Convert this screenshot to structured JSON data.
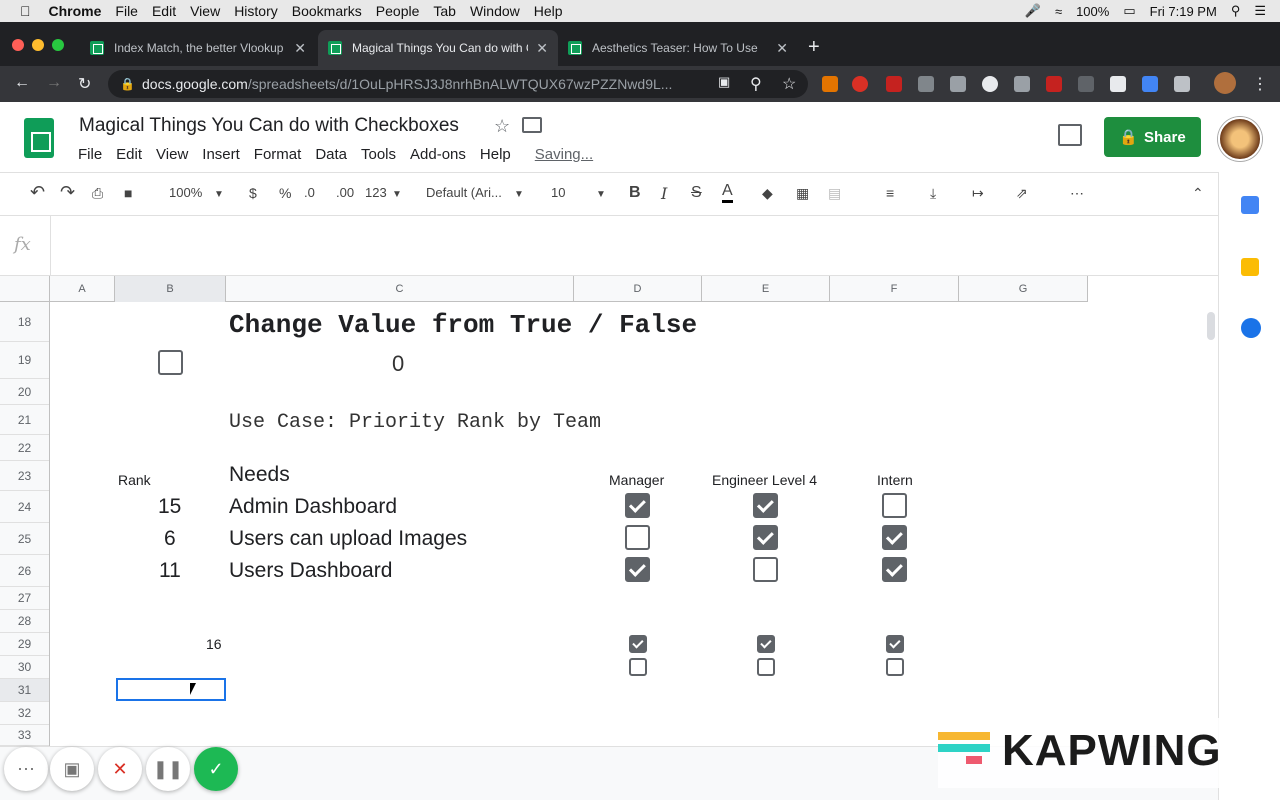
{
  "macos_menubar": {
    "app_name": "Chrome",
    "menus": [
      "File",
      "Edit",
      "View",
      "History",
      "Bookmarks",
      "People",
      "Tab",
      "Window",
      "Help"
    ],
    "battery": "100%",
    "clock": "Fri 7:19 PM"
  },
  "browser": {
    "tabs": [
      {
        "title": "Index Match, the better Vlookup",
        "active": false
      },
      {
        "title": "Magical Things You Can do with Checkboxes",
        "active": true
      },
      {
        "title": "Aesthetics Teaser: How To Use",
        "active": false
      }
    ],
    "url_host": "docs.google.com",
    "url_path": "/spreadsheets/d/1OuLpHRSJ3J8nrhBnALWTQUX67wzPZZNwd9L..."
  },
  "docs": {
    "title": "Magical Things You Can do with Checkboxes",
    "menus": [
      "File",
      "Edit",
      "View",
      "Insert",
      "Format",
      "Data",
      "Tools",
      "Add-ons",
      "Help"
    ],
    "save_status": "Saving...",
    "share_label": "Share"
  },
  "toolbar": {
    "zoom": "100%",
    "currency": "$",
    "percent": "%",
    "decrease_decimals": ".0",
    "increase_decimals": ".00",
    "more_formats": "123",
    "font": "Default (Ari...",
    "font_size": "10",
    "bold": "B",
    "italic": "I",
    "strike": "S",
    "text_color": "A"
  },
  "formula_bar": {
    "fx": "fx",
    "value": ""
  },
  "sheet": {
    "columns": [
      "A",
      "B",
      "C",
      "D",
      "E",
      "F",
      "G"
    ],
    "rows": [
      "18",
      "19",
      "20",
      "21",
      "22",
      "23",
      "24",
      "25",
      "26",
      "27",
      "28",
      "29",
      "30",
      "31",
      "32",
      "33"
    ],
    "heading": "Change Value from True / False",
    "demo_value": "0",
    "demo_checkbox_checked": false,
    "use_case": "Use Case: Priority Rank by Team",
    "rank_header": "Rank",
    "needs_header": "Needs",
    "teams": [
      "Manager",
      "Engineer Level 4",
      "Intern"
    ],
    "items": [
      {
        "rank": "15",
        "need": "Admin Dashboard",
        "checks": [
          true,
          true,
          false
        ]
      },
      {
        "rank": "6",
        "need": "Users can upload Images",
        "checks": [
          false,
          true,
          true
        ]
      },
      {
        "rank": "11",
        "need": "Users Dashboard",
        "checks": [
          true,
          false,
          true
        ]
      }
    ],
    "row29_value": "16",
    "row29_checks": [
      true,
      true,
      true
    ],
    "row30_checks": [
      false,
      false,
      false
    ]
  },
  "watermark": {
    "text": "KAPWING"
  },
  "colors": {
    "share_green": "#1e8e3e",
    "sheets_green": "#0f9d58",
    "selection_blue": "#1a73e8",
    "check_gray": "#5f6368"
  }
}
